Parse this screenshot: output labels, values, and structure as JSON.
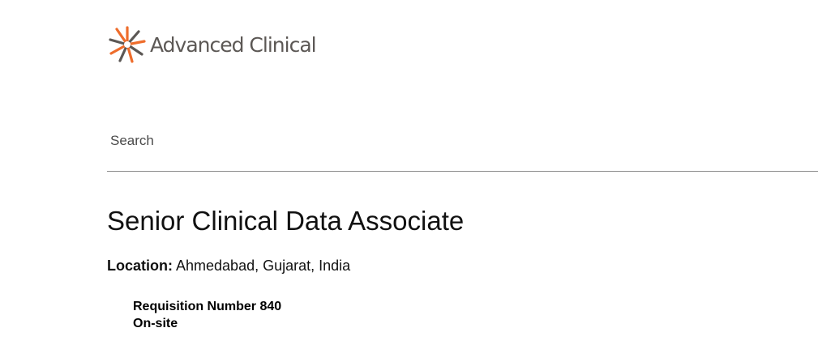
{
  "brand": {
    "name": "Advanced Clinical",
    "logo_colors": {
      "orange": "#ee6d2c",
      "gray": "#5c5855"
    }
  },
  "search": {
    "placeholder": "Search"
  },
  "job": {
    "title": "Senior Clinical Data Associate",
    "location_label": "Location:",
    "location_value": "Ahmedabad, Gujarat, India",
    "requisition": "Requisition Number 840",
    "work_mode": "On-site"
  }
}
